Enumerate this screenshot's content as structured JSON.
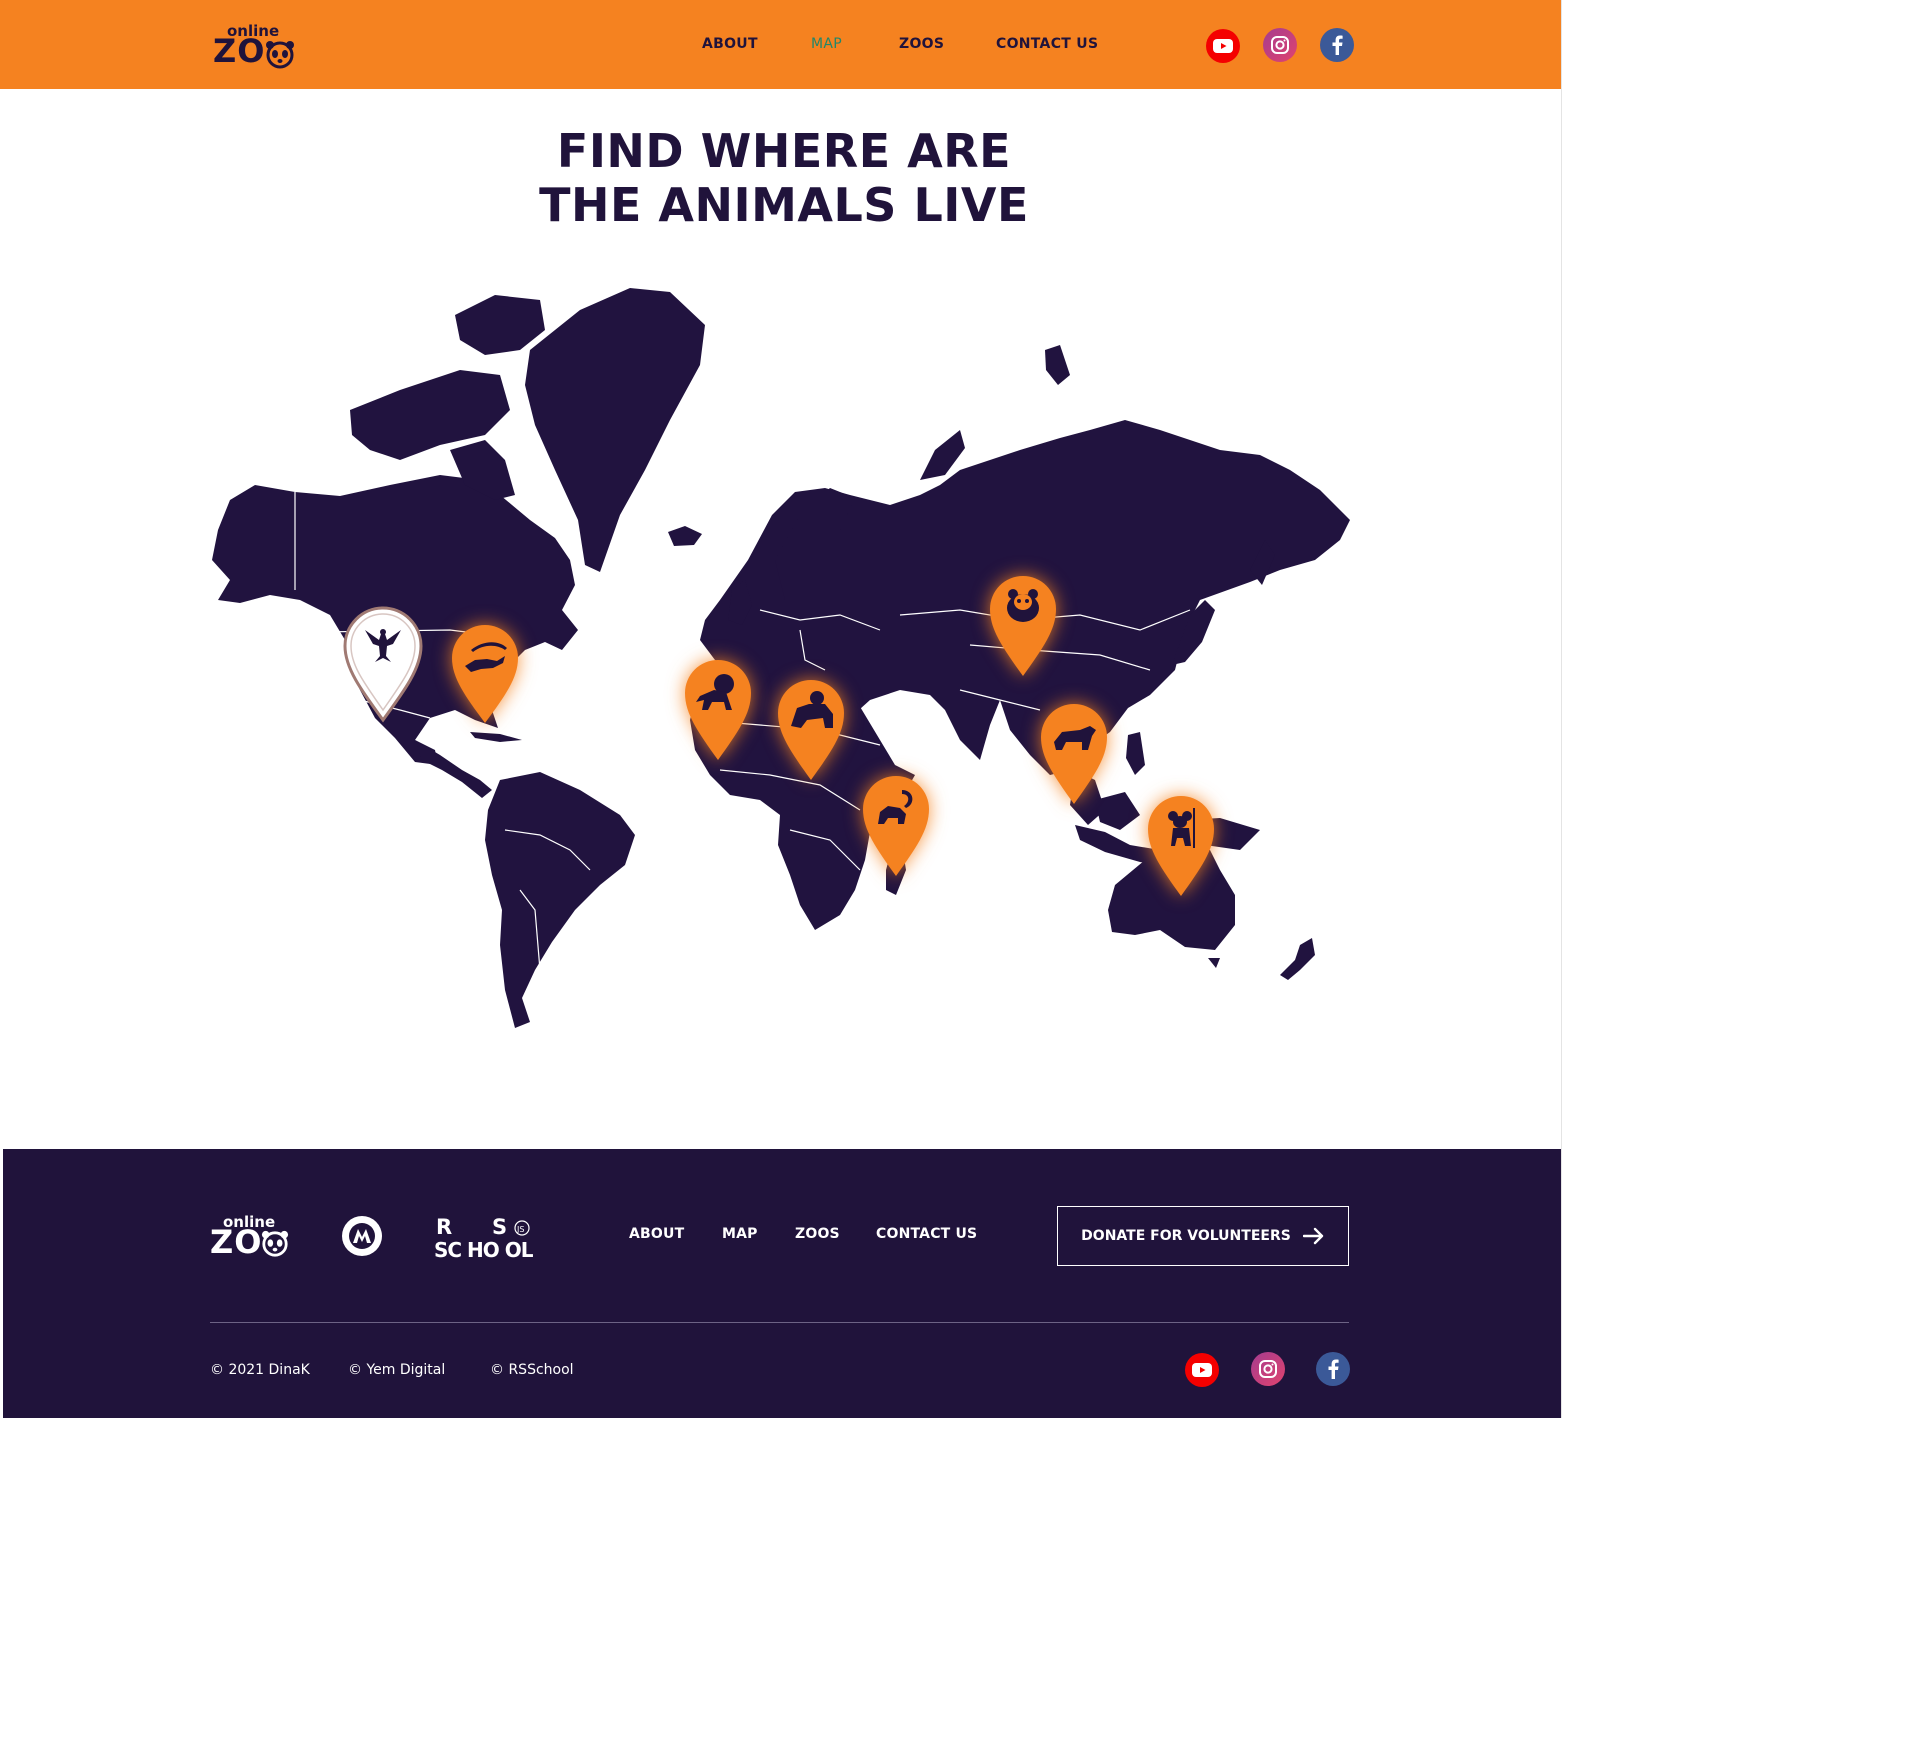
{
  "header": {
    "logo": {
      "small": "online",
      "big": "ZOO"
    },
    "nav": [
      {
        "label": "ABOUT",
        "active": false
      },
      {
        "label": "MAP",
        "active": true
      },
      {
        "label": "ZOOS",
        "active": false
      },
      {
        "label": "CONTACT US",
        "active": false
      }
    ],
    "social": [
      {
        "name": "youtube-icon",
        "color": "#f40000"
      },
      {
        "name": "instagram-icon",
        "color": "#c13584"
      },
      {
        "name": "facebook-icon",
        "color": "#3b5998"
      }
    ]
  },
  "main": {
    "title_line1": "FIND WHERE ARE",
    "title_line2": "THE ANIMALS LIVE",
    "pins": [
      {
        "animal": "eagle",
        "selected": true
      },
      {
        "animal": "alligator",
        "selected": false
      },
      {
        "animal": "lion",
        "selected": false
      },
      {
        "animal": "gorilla",
        "selected": false
      },
      {
        "animal": "panda",
        "selected": false
      },
      {
        "animal": "tiger",
        "selected": false
      },
      {
        "animal": "lemur",
        "selected": false
      },
      {
        "animal": "koala",
        "selected": false
      }
    ]
  },
  "footer": {
    "logo": {
      "small": "online",
      "big": "ZOO"
    },
    "rsschool_logo": "RS SCHOOL",
    "nav": [
      "ABOUT",
      "MAP",
      "ZOOS",
      "CONTACT US"
    ],
    "donate_label": "DONATE FOR VOLUNTEERS",
    "copyright": [
      "© 2021 DinaK",
      "© Yem Digital",
      "© RSSchool"
    ]
  },
  "colors": {
    "brand_orange": "#f58220",
    "dark_purple": "#20133b",
    "active_nav": "#23876a"
  }
}
